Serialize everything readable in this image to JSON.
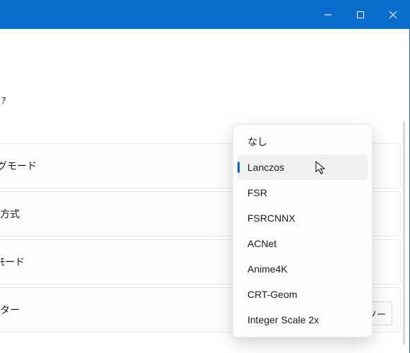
{
  "window": {
    "buttons": {
      "min": "minimize",
      "max": "maximize",
      "close": "close"
    }
  },
  "header_fragment": "ｱ",
  "rows": [
    {
      "label_fragment": "グモード"
    },
    {
      "label_fragment": "方式"
    },
    {
      "label_fragment": "ﾓード"
    },
    {
      "label_fragment": "ター"
    }
  ],
  "button_fragment": "ソー",
  "menu": {
    "items": [
      {
        "label": "なし",
        "selected": false,
        "hover": false
      },
      {
        "label": "Lanczos",
        "selected": true,
        "hover": true
      },
      {
        "label": "FSR",
        "selected": false,
        "hover": false
      },
      {
        "label": "FSRCNNX",
        "selected": false,
        "hover": false
      },
      {
        "label": "ACNet",
        "selected": false,
        "hover": false
      },
      {
        "label": "Anime4K",
        "selected": false,
        "hover": false
      },
      {
        "label": "CRT-Geom",
        "selected": false,
        "hover": false
      },
      {
        "label": "Integer Scale 2x",
        "selected": false,
        "hover": false
      }
    ]
  }
}
